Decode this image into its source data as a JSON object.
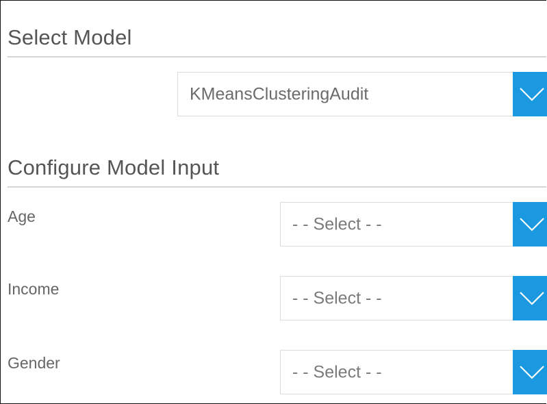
{
  "select_model": {
    "title": "Select Model",
    "model_value": "KMeansClusteringAudit",
    "dropdown_icon": "chevron-down-icon"
  },
  "configure_input": {
    "title": "Configure Model Input",
    "fields": [
      {
        "label": "Age",
        "value": "- - Select - -"
      },
      {
        "label": "Income",
        "value": "- - Select - -"
      },
      {
        "label": "Gender",
        "value": "- - Select - -"
      }
    ]
  },
  "colors": {
    "accent": "#1a98e0",
    "border": "#dcdcdc",
    "text": "#555555"
  }
}
